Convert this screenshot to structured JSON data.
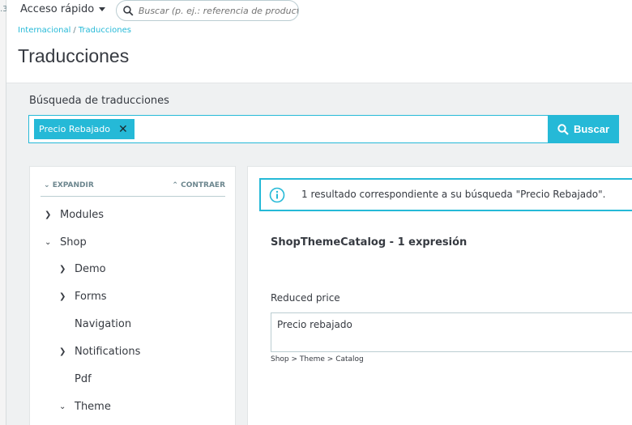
{
  "sidebar_rail": {
    "version_fragment": ".3"
  },
  "topbar": {
    "quick_access_label": "Acceso rápido",
    "search_placeholder": "Buscar (p. ej.: referencia de producto, no"
  },
  "breadcrumb": {
    "items": [
      "Internacional",
      "Traducciones"
    ]
  },
  "page": {
    "title": "Traducciones"
  },
  "search": {
    "label": "Búsqueda de traducciones",
    "tag": "Precio Rebajado",
    "button_label": "Buscar"
  },
  "tree": {
    "expand_label": "EXPANDIR",
    "collapse_label": "CONTRAER",
    "items": [
      {
        "label": "Modules",
        "chevron": "right"
      },
      {
        "label": "Shop",
        "chevron": "down"
      },
      {
        "label": "Demo",
        "chevron": "right"
      },
      {
        "label": "Forms",
        "chevron": "right"
      },
      {
        "label": "Navigation",
        "chevron": "none"
      },
      {
        "label": "Notifications",
        "chevron": "right"
      },
      {
        "label": "Pdf",
        "chevron": "none"
      },
      {
        "label": "Theme",
        "chevron": "down"
      }
    ]
  },
  "results": {
    "alert_message": "1 resultado correspondiente a su búsqueda \"Precio Rebajado\".",
    "domain_title": "ShopThemeCatalog - 1 expresión",
    "field_label": "Reduced price",
    "field_value": "Precio rebajado",
    "path": "Shop > Theme > Catalog"
  },
  "colors": {
    "accent": "#25b9d7",
    "text": "#363a41",
    "background": "#eff1f2"
  }
}
